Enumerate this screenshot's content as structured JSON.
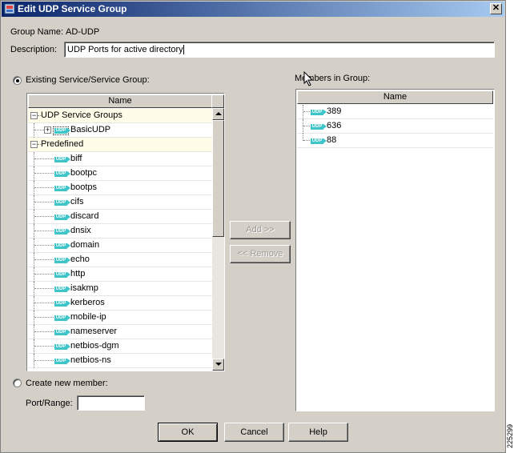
{
  "window": {
    "title": "Edit UDP Service Group"
  },
  "form": {
    "group_name_label": "Group Name:",
    "group_name_value": "AD-UDP",
    "description_label": "Description:",
    "description_value": "UDP Ports for active directory"
  },
  "existing": {
    "radio_label": "Existing Service/Service Group:",
    "selected": true,
    "column_header": "Name",
    "groups": [
      {
        "label": "UDP Service Groups",
        "children": [
          "BasicUDP"
        ]
      },
      {
        "label": "Predefined",
        "children": [
          "biff",
          "bootpc",
          "bootps",
          "cifs",
          "discard",
          "dnsix",
          "domain",
          "echo",
          "http",
          "isakmp",
          "kerberos",
          "mobile-ip",
          "nameserver",
          "netbios-dgm",
          "netbios-ns"
        ]
      }
    ]
  },
  "members": {
    "label": "Members in Group:",
    "column_header": "Name",
    "items": [
      "389",
      "636",
      "88"
    ]
  },
  "buttons": {
    "add": "Add >>",
    "remove": "<< Remove",
    "ok": "OK",
    "cancel": "Cancel",
    "help": "Help"
  },
  "create": {
    "radio_label": "Create new member:",
    "port_range_label": "Port/Range:",
    "port_range_value": ""
  },
  "badge_text": "UDP",
  "side_code": "225299",
  "colors": {
    "title_start": "#0a246a",
    "title_end": "#a6caf0",
    "udp_badge": "#3fc5c9",
    "group_row": "#fffce8"
  }
}
